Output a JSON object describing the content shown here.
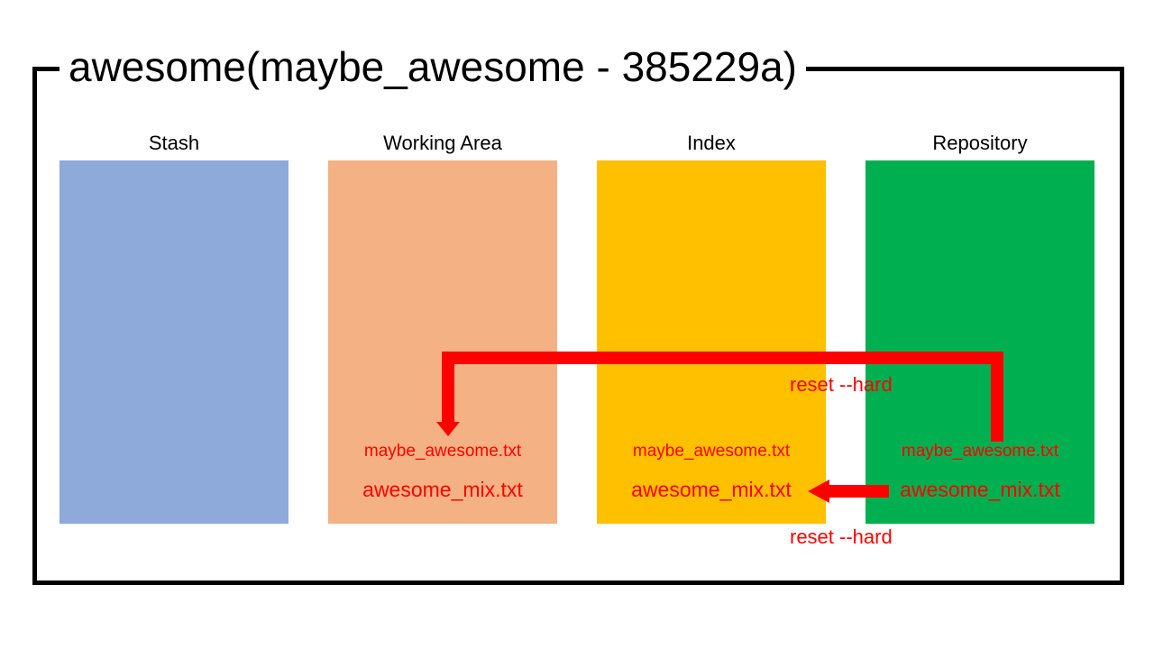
{
  "title": "awesome(maybe_awesome - 385229a)",
  "columns": [
    {
      "label": "Stash",
      "color": "#8EAADB",
      "files": []
    },
    {
      "label": "Working Area",
      "color": "#F4B183",
      "files": [
        "maybe_awesome.txt",
        "awesome_mix.txt"
      ]
    },
    {
      "label": "Index",
      "color": "#FFC000",
      "files": [
        "maybe_awesome.txt",
        "awesome_mix.txt"
      ]
    },
    {
      "label": "Repository",
      "color": "#00B050",
      "files": [
        "maybe_awesome.txt",
        "awesome_mix.txt"
      ]
    }
  ],
  "arrows": [
    {
      "label": "reset --hard",
      "from": "Repository",
      "to": "Working Area",
      "file": "maybe_awesome.txt"
    },
    {
      "label": "reset --hard",
      "from": "Repository",
      "to": "Index",
      "file": "awesome_mix.txt"
    }
  ],
  "colors": {
    "arrow": "#FF0000",
    "text": "#FF0000",
    "frame": "#000000"
  }
}
